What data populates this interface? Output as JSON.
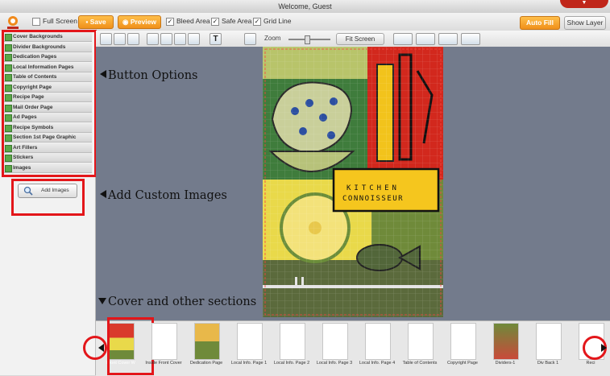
{
  "window": {
    "title": "Welcome, Guest"
  },
  "toolbar": {
    "full_screen_label": "Full Screen",
    "save_label": "Save",
    "preview_label": "Preview",
    "bleed_area_label": "Bleed Area",
    "safe_area_label": "Safe Area",
    "grid_line_label": "Grid Line",
    "auto_fill_label": "Auto Fill",
    "show_layer_label": "Show Layer",
    "full_screen_checked": false,
    "bleed_area_checked": true,
    "safe_area_checked": true,
    "grid_line_checked": true,
    "accent_color": "#f0901a"
  },
  "editor_toolbar": {
    "zoom_label": "Zoom",
    "fit_screen_label": "Fit Screen",
    "text_tool_glyph": "T",
    "zoom_level": 0.4
  },
  "sidebar": {
    "categories": [
      {
        "label": "Cover Backgrounds"
      },
      {
        "label": "Divider Backgrounds"
      },
      {
        "label": "Dedication Pages"
      },
      {
        "label": "Local Information Pages"
      },
      {
        "label": "Table of Contents"
      },
      {
        "label": "Copyright Page"
      },
      {
        "label": "Recipe Page"
      },
      {
        "label": "Mail Order Page"
      },
      {
        "label": "Ad Pages"
      },
      {
        "label": "Recipe Symbols"
      },
      {
        "label": "Section 1st Page Graphic"
      },
      {
        "label": "Art Fillers"
      },
      {
        "label": "Stickers"
      },
      {
        "label": "Images"
      }
    ],
    "add_images_label": "Add Images"
  },
  "annotations": {
    "button_options": "Button Options",
    "add_custom_images": "Add Custom Images",
    "cover_sections": "Cover and other sections",
    "highlight_color": "#e3161a"
  },
  "cover": {
    "line1": "KITCHEN",
    "line2": "CONNOISSEUR"
  },
  "filmstrip": {
    "pages": [
      {
        "label": "Front Cover W",
        "selected": true
      },
      {
        "label": "Inside Front Cover"
      },
      {
        "label": "Dedication Page"
      },
      {
        "label": "Local Info. Page 1"
      },
      {
        "label": "Local Info. Page 2"
      },
      {
        "label": "Local Info. Page 3"
      },
      {
        "label": "Local Info. Page 4"
      },
      {
        "label": "Table of Contents"
      },
      {
        "label": "Copyright Page"
      },
      {
        "label": "Dividers-1"
      },
      {
        "label": "Div Back 1"
      },
      {
        "label": "Reci"
      }
    ],
    "prev_icon": "chevron-left-icon",
    "next_icon": "chevron-right-icon"
  }
}
